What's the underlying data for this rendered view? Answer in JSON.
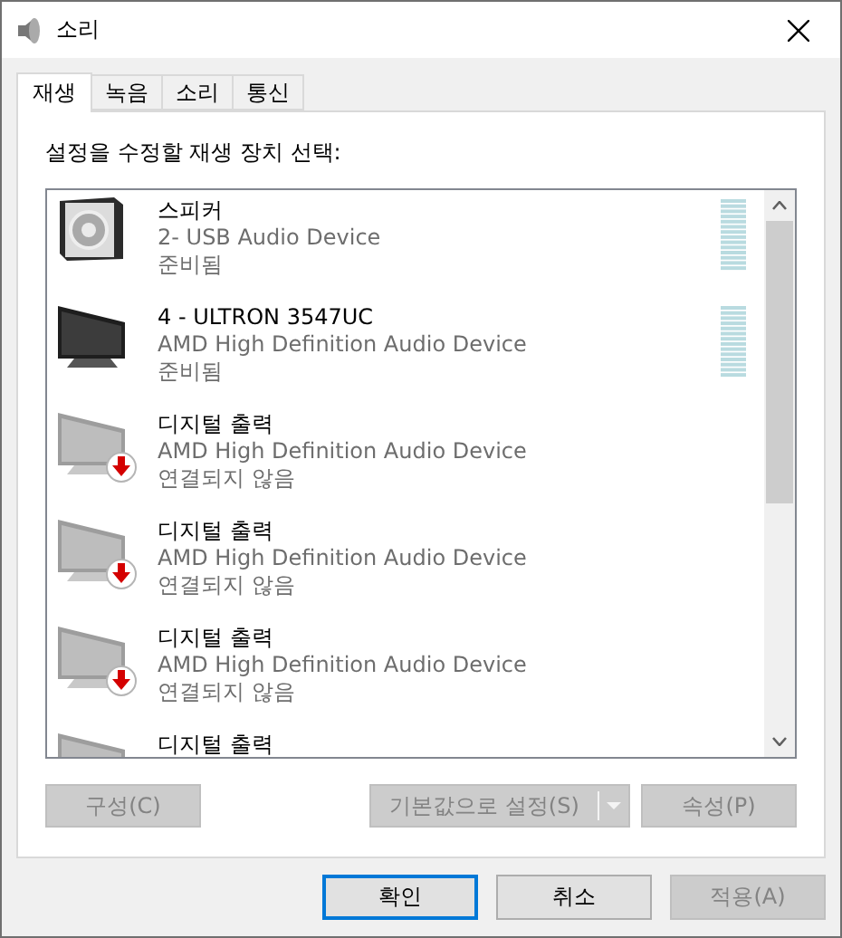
{
  "window": {
    "title": "소리"
  },
  "tabs": [
    {
      "label": "재생",
      "selected": true
    },
    {
      "label": "녹음",
      "selected": false
    },
    {
      "label": "소리",
      "selected": false
    },
    {
      "label": "통신",
      "selected": false
    }
  ],
  "instruction": "설정을 수정할 재생 장치 선택:",
  "devices": [
    {
      "kind": "speaker",
      "name": "스피커",
      "description": "2- USB Audio Device",
      "status": "준비됨",
      "connected": true
    },
    {
      "kind": "monitor",
      "name": "4 - ULTRON 3547UC",
      "description": "AMD High Definition Audio Device",
      "status": "준비됨",
      "connected": true
    },
    {
      "kind": "monitor",
      "name": "디지털 출력",
      "description": "AMD High Definition Audio Device",
      "status": "연결되지 않음",
      "connected": false
    },
    {
      "kind": "monitor",
      "name": "디지털 출력",
      "description": "AMD High Definition Audio Device",
      "status": "연결되지 않음",
      "connected": false
    },
    {
      "kind": "monitor",
      "name": "디지털 출력",
      "description": "AMD High Definition Audio Device",
      "status": "연결되지 않음",
      "connected": false
    },
    {
      "kind": "monitor",
      "name": "디지털 출력",
      "connected": false
    }
  ],
  "panel_buttons": {
    "configure": {
      "label": "구성(C)",
      "disabled": true
    },
    "set_default": {
      "label": "기본값으로 설정(S)",
      "disabled": true
    },
    "properties": {
      "label": "속성(P)",
      "disabled": true
    }
  },
  "dialog_buttons": [
    {
      "label": "확인",
      "default": true,
      "disabled": false
    },
    {
      "label": "취소",
      "default": false,
      "disabled": false
    },
    {
      "label": "적용(A)",
      "default": false,
      "disabled": true
    }
  ]
}
